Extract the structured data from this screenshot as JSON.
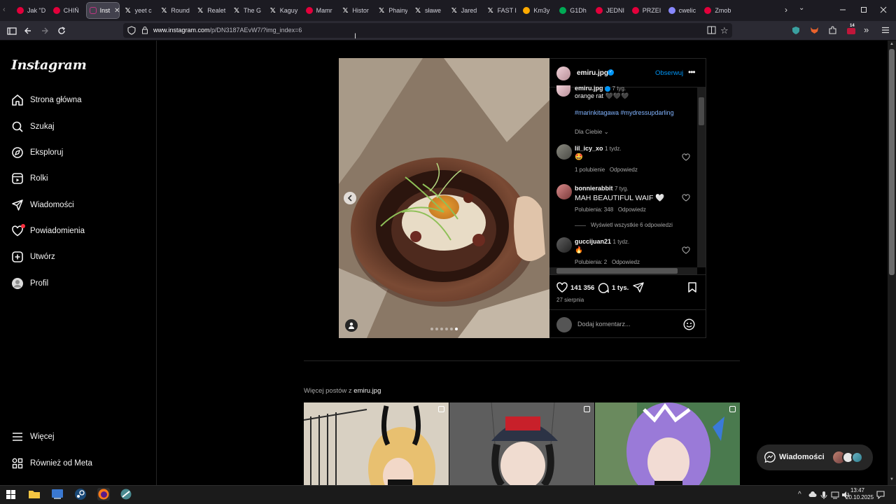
{
  "browser": {
    "tabs": [
      {
        "label": "Jak \"D",
        "icon": "heart-red-icon",
        "color": "#e3003b"
      },
      {
        "label": "CHIŃ",
        "icon": "heart-red-icon",
        "color": "#e3003b"
      },
      {
        "label": "Inst",
        "icon": "instagram-icon",
        "color": "#c13584",
        "active": true
      },
      {
        "label": "yeet c",
        "icon": "x-icon",
        "color": "#ffffff"
      },
      {
        "label": "Round",
        "icon": "x-icon",
        "color": "#ffffff"
      },
      {
        "label": "Realet",
        "icon": "x-icon",
        "color": "#ffffff"
      },
      {
        "label": "The G",
        "icon": "x-icon",
        "color": "#ffffff"
      },
      {
        "label": "Kaguy",
        "icon": "x-icon",
        "color": "#ffffff"
      },
      {
        "label": "Mamr",
        "icon": "heart-red-icon",
        "color": "#e3003b"
      },
      {
        "label": "Histor",
        "icon": "x-icon",
        "color": "#ffffff"
      },
      {
        "label": "Phainy",
        "icon": "x-icon",
        "color": "#ffffff"
      },
      {
        "label": "sławe",
        "icon": "x-icon",
        "color": "#ffffff"
      },
      {
        "label": "Jared",
        "icon": "x-icon",
        "color": "#ffffff"
      },
      {
        "label": "FAST I",
        "icon": "x-icon",
        "color": "#ffffff"
      },
      {
        "label": "Km3y",
        "icon": "site-icon",
        "color": "#ffaa00"
      },
      {
        "label": "G1Dh",
        "icon": "site-icon",
        "color": "#00aa55"
      },
      {
        "label": "JEDNI",
        "icon": "heart-red-icon",
        "color": "#e3003b"
      },
      {
        "label": "PRZEI",
        "icon": "heart-red-icon",
        "color": "#e3003b"
      },
      {
        "label": "cwelic",
        "icon": "site-icon",
        "color": "#8888ff"
      },
      {
        "label": "Zmob",
        "icon": "heart-red-icon",
        "color": "#e3003b"
      }
    ],
    "url_host": "www.instagram.com",
    "url_path": "/p/DN3187AEvW7/?img_index=6",
    "extension_badge": "14"
  },
  "sidebar": {
    "logo": "Instagram",
    "items": [
      {
        "label": "Strona główna",
        "icon": "home-icon"
      },
      {
        "label": "Szukaj",
        "icon": "search-icon"
      },
      {
        "label": "Eksploruj",
        "icon": "compass-icon"
      },
      {
        "label": "Rolki",
        "icon": "reels-icon"
      },
      {
        "label": "Wiadomości",
        "icon": "send-icon"
      },
      {
        "label": "Powiadomienia",
        "icon": "heart-icon"
      },
      {
        "label": "Utwórz",
        "icon": "plus-square-icon"
      },
      {
        "label": "Profil",
        "icon": "profile-icon"
      }
    ],
    "more": "Więcej",
    "meta": "Również od Meta"
  },
  "post": {
    "author": "emiru.jpg",
    "follow": "Obserwuj",
    "caption_time": "7 tyg.",
    "caption": "orange rat 🖤🖤🖤",
    "hashtags": "#marinkitagawa #mydressupdarling",
    "for_you": "Dla Ciebie",
    "likes": "141 356",
    "comments_count": "1 tys.",
    "date": "27 sierpnia",
    "add_comment": "Dodaj komentarz...",
    "comments": [
      {
        "user": "lil_icy_xo",
        "time": "1 tydz.",
        "text": "🤩",
        "likes": "1 polubienie",
        "reply": "Odpowiedz"
      },
      {
        "user": "bonnierabbit",
        "time": "7 tyg.",
        "text": "MAH BEAUTIFUL WAIF 🤍",
        "likes": "Polubienia: 348",
        "reply": "Odpowiedz",
        "view_replies": "Wyświetl wszystkie 6 odpowiedzi"
      },
      {
        "user": "guccijuan21",
        "time": "1 tydz.",
        "text": "🔥",
        "likes": "Polubienia: 2",
        "reply": "Odpowiedz"
      }
    ],
    "carousel_active": 6,
    "carousel_total": 6
  },
  "more_posts": {
    "prefix": "Więcej postów z ",
    "user": "emiru.jpg"
  },
  "messages": {
    "label": "Wiadomości"
  },
  "taskbar": {
    "time": "13:47",
    "date": "20.10.2025"
  }
}
